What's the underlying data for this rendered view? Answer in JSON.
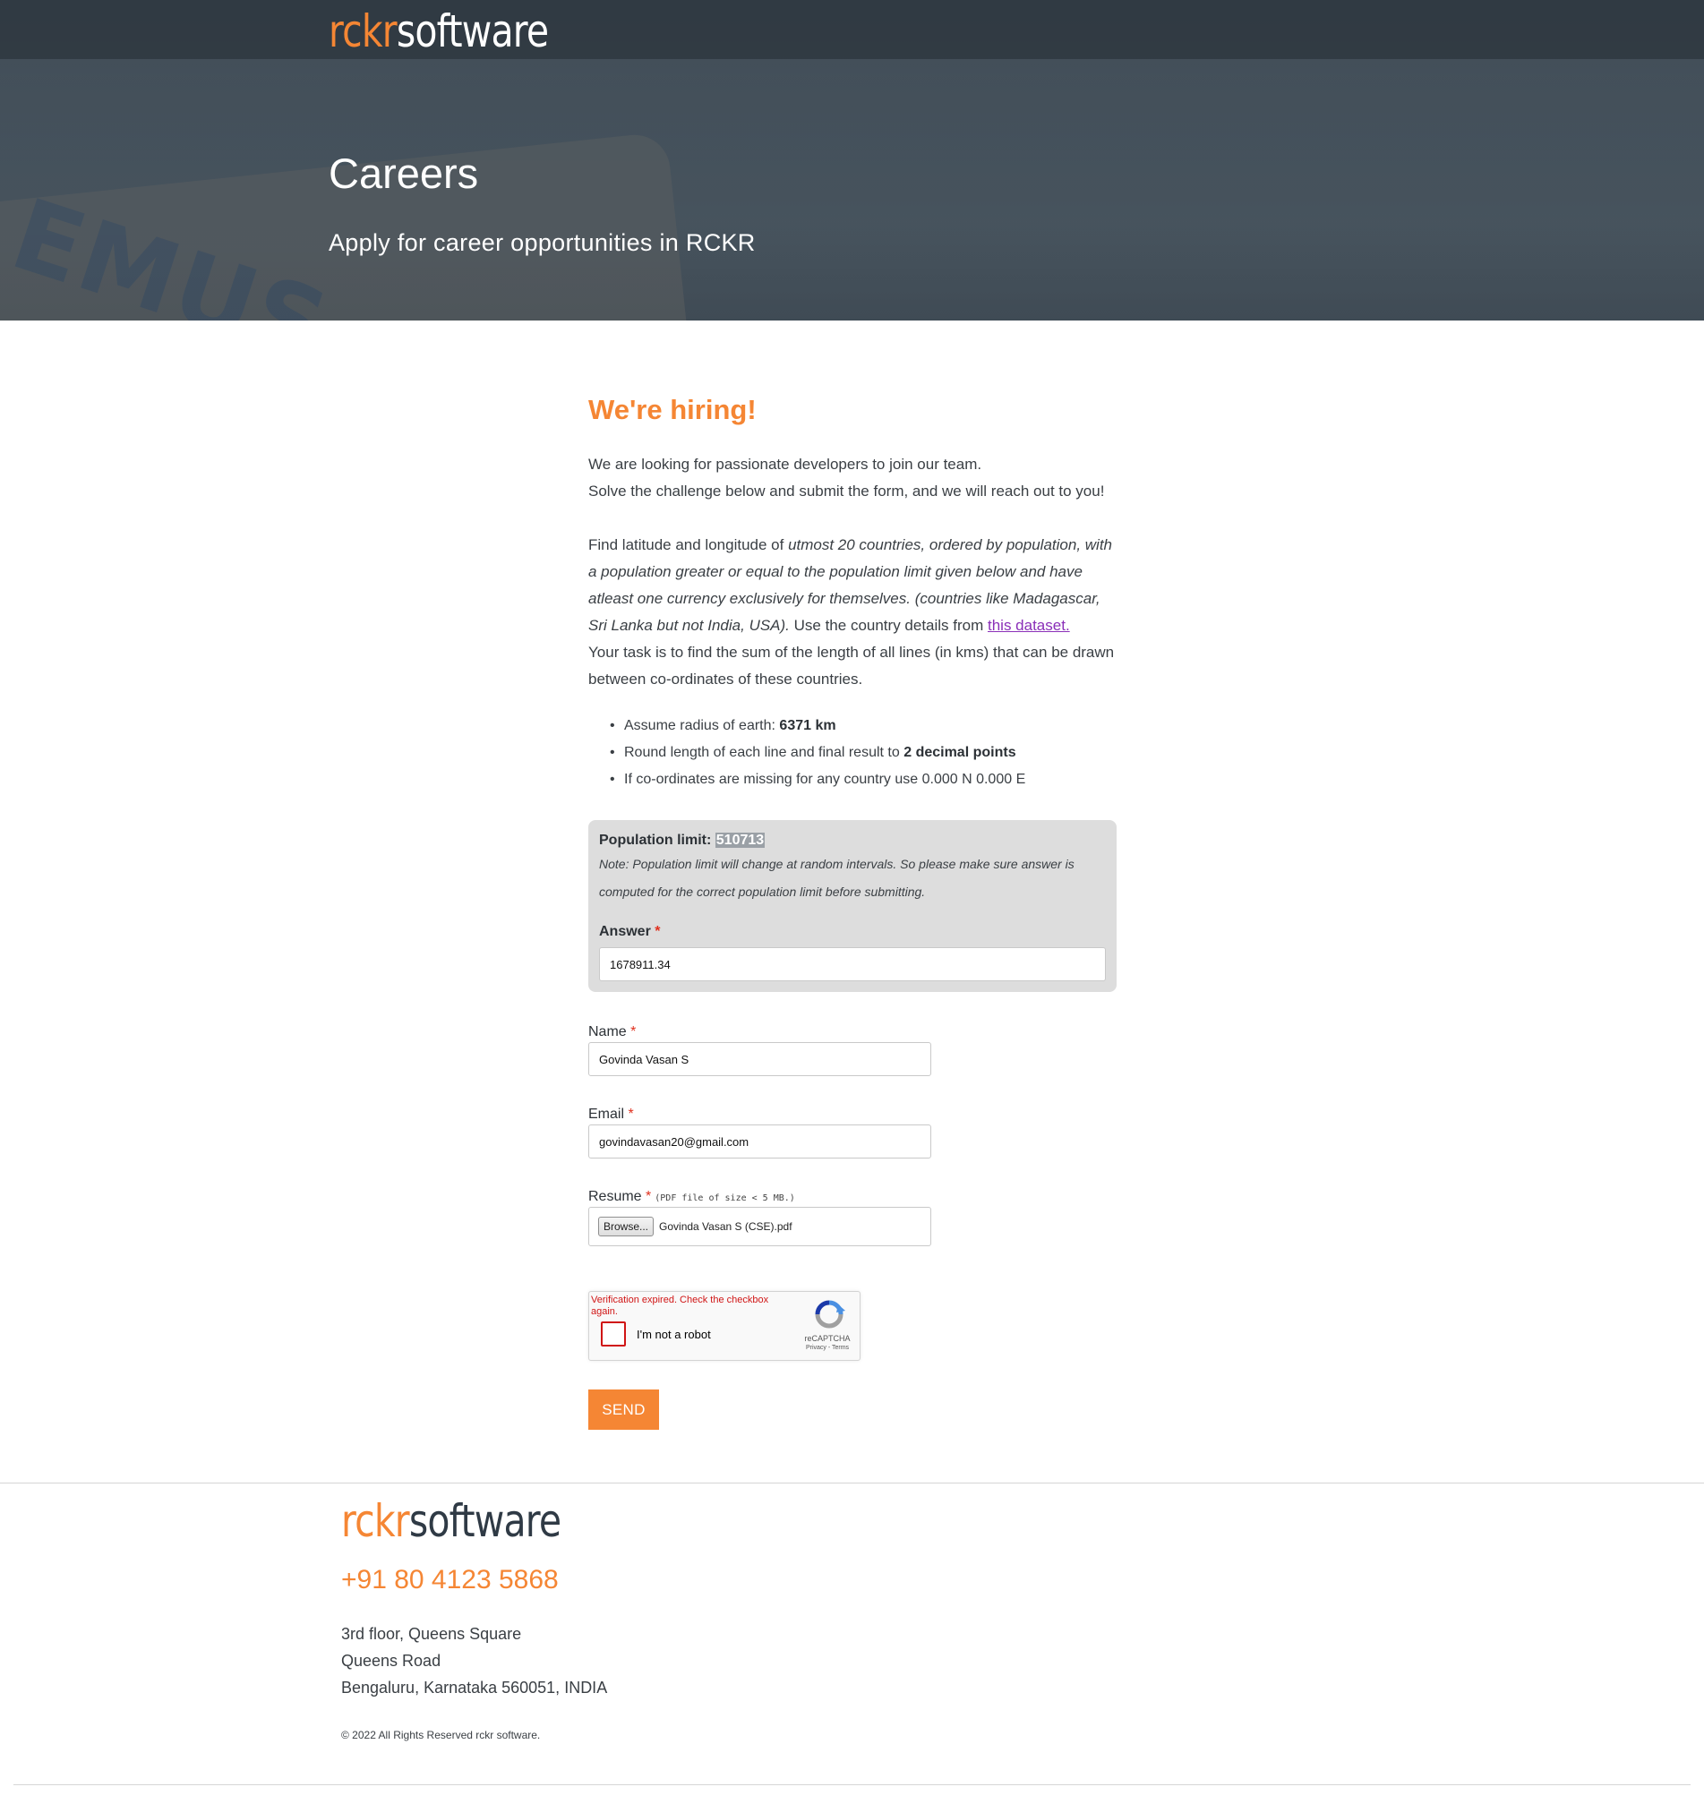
{
  "header": {
    "logo_part1": "rckr",
    "logo_part2": "software",
    "title": "Careers",
    "subtitle": "Apply for career opportunities in RCKR"
  },
  "intro": {
    "heading": "We're hiring!",
    "line1": "We are looking for passionate developers to join our team.",
    "line2": "Solve the challenge below and submit the form, and we will reach out to you!"
  },
  "challenge": {
    "text_a": "Find latitude and longitude of ",
    "text_b_italic": "utmost 20 countries, ordered by population, with a population greater or equal to the population limit given below and have atleast one currency exclusively for themselves. (countries like Madagascar, Sri Lanka but not India, USA).",
    "text_c": " Use the country details from ",
    "dataset_link": "this dataset.",
    "task": "Your task is to find the sum of the length of all lines (in kms) that can be drawn between co-ordinates of these countries.",
    "bullets": [
      {
        "text": "Assume radius of earth: ",
        "bold": "6371 km"
      },
      {
        "text": "Round length of each line and final result to ",
        "bold": "2 decimal points"
      },
      {
        "text": "If co-ordinates are missing for any country use 0.000 N 0.000 E",
        "bold": ""
      }
    ]
  },
  "population_box": {
    "label": "Population limit: ",
    "value": "510713",
    "note": "Note: Population limit will change at random intervals. So please make sure answer is computed for the correct population limit before submitting.",
    "answer_label": "Answer",
    "answer_value": "1678911.34"
  },
  "form": {
    "required_mark": "*",
    "name_label": "Name",
    "name_value": "Govinda Vasan S",
    "email_label": "Email",
    "email_value": "govindavasan20@gmail.com",
    "resume_label": "Resume",
    "resume_hint": "(PDF file of size < 5 MB.)",
    "browse_label": "Browse...",
    "file_name": "Govinda Vasan S (CSE).pdf",
    "send_label": "SEND"
  },
  "captcha": {
    "error": "Verification expired. Check the checkbox again.",
    "label": "I'm not a robot",
    "brand": "reCAPTCHA",
    "links": "Privacy - Terms"
  },
  "footer": {
    "logo_part1": "rckr",
    "logo_part2": "software",
    "phone": "+91 80 4123 5868",
    "address": [
      "3rd floor, Queens Square",
      "Queens Road",
      "Bengaluru, Karnataka 560051, INDIA"
    ],
    "copyright": "© 2022 All Rights Reserved rckr software."
  },
  "colors": {
    "accent": "#f58634",
    "link": "#8a2fb8",
    "required": "#e0301e",
    "hero": "#44515c"
  }
}
